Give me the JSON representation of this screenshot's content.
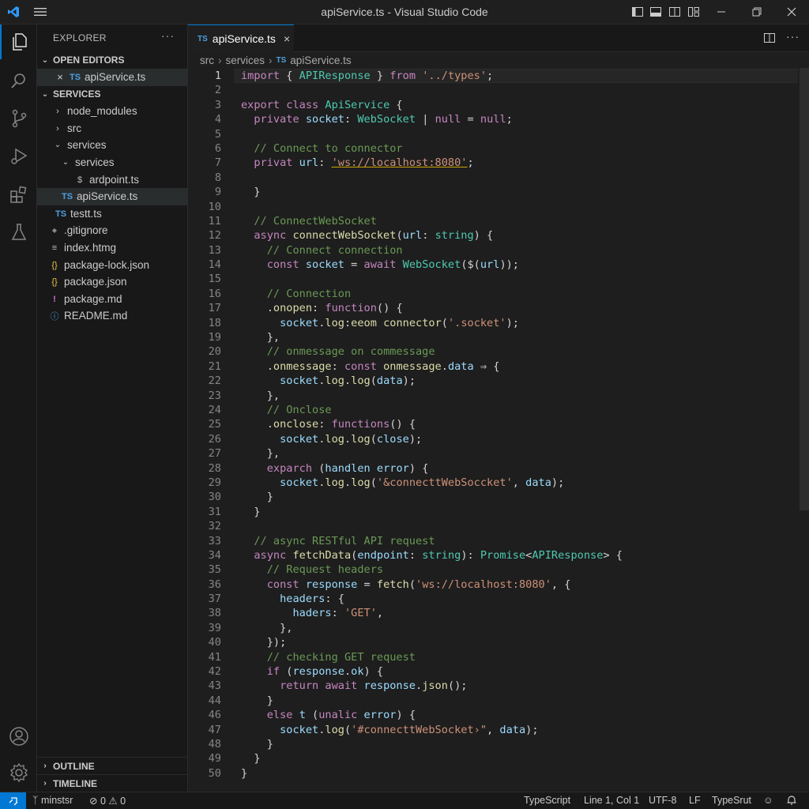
{
  "window": {
    "title": "apiService.ts - Visual Studio Code"
  },
  "activity_bar": [
    "explorer-icon",
    "search-icon",
    "source-control-icon",
    "run-debug-icon",
    "extensions-icon",
    "testing-icon",
    "account-icon",
    "manage-gear-icon"
  ],
  "sidebar": {
    "title": "EXPLORER",
    "more": "···",
    "open_editors": {
      "label": "OPEN EDITORS",
      "items": [
        {
          "icon": "TS",
          "label": "apiService.ts"
        }
      ]
    },
    "project": {
      "label": "SERVICES",
      "items": [
        {
          "chev": "›",
          "icon": "",
          "label": "node_modules"
        },
        {
          "chev": "›",
          "icon": "",
          "label": "src"
        },
        {
          "chev": "⌄",
          "icon": "",
          "label": "services"
        },
        {
          "chev": "⌄",
          "icon": "",
          "label": "services"
        },
        {
          "chev": "",
          "icon": "$",
          "label": "ardpoint.ts"
        },
        {
          "chev": "",
          "icon": "TS",
          "label": "apiService.ts"
        },
        {
          "chev": "",
          "icon": "TS",
          "label": "testt.ts"
        },
        {
          "chev": "",
          "icon": "◆",
          "label": ".gitignore"
        },
        {
          "chev": "",
          "icon": "≡",
          "label": "index.htmg"
        },
        {
          "chev": "",
          "icon": "{}",
          "label": "package-lock.json"
        },
        {
          "chev": "",
          "icon": "{}",
          "label": "package.json"
        },
        {
          "chev": "",
          "icon": "!",
          "label": "package.md"
        },
        {
          "chev": "",
          "icon": "ⓘ",
          "label": "README.md"
        }
      ]
    },
    "outline_label": "OUTLINE",
    "timeline_label": "TIMELINE"
  },
  "tab": {
    "icon": "TS",
    "label": "apiService.ts",
    "close": "×"
  },
  "breadcrumb": {
    "parts": [
      "src",
      "services",
      "apiService.ts"
    ],
    "file_icon": "TS",
    "sep": "›"
  },
  "editor": {
    "current_line": 1,
    "lines": [
      [
        [
          "kw",
          "import"
        ],
        [
          "p",
          " { "
        ],
        [
          "ty",
          "APIResponse"
        ],
        [
          "p",
          " } "
        ],
        [
          "kw",
          "from"
        ],
        [
          "p",
          " "
        ],
        [
          "str",
          "'../types'"
        ],
        [
          "p",
          ";"
        ]
      ],
      [],
      [
        [
          "kw",
          "export"
        ],
        [
          "p",
          " "
        ],
        [
          "kw",
          "class"
        ],
        [
          "p",
          " "
        ],
        [
          "ty",
          "ApiService"
        ],
        [
          "p",
          " {"
        ]
      ],
      [
        [
          "p",
          "  "
        ],
        [
          "kw",
          "private"
        ],
        [
          "p",
          " "
        ],
        [
          "var",
          "socket"
        ],
        [
          "p",
          ": "
        ],
        [
          "ty",
          "WebSocket"
        ],
        [
          "p",
          " | "
        ],
        [
          "kw",
          "null"
        ],
        [
          "p",
          " = "
        ],
        [
          "kw",
          "null"
        ],
        [
          "p",
          ";"
        ]
      ],
      [],
      [
        [
          "p",
          "  "
        ],
        [
          "cm",
          "// Connect to connector"
        ]
      ],
      [
        [
          "p",
          "  "
        ],
        [
          "kw",
          "privat"
        ],
        [
          "p",
          " "
        ],
        [
          "var",
          "url"
        ],
        [
          "p",
          ": "
        ],
        [
          "strU",
          "'ws://localhost:8080'"
        ],
        [
          "p",
          ";"
        ]
      ],
      [],
      [
        [
          "p",
          "  }"
        ]
      ],
      [],
      [
        [
          "p",
          "  "
        ],
        [
          "cm",
          "// ConnectWebSocket"
        ]
      ],
      [
        [
          "p",
          "  "
        ],
        [
          "kw",
          "async"
        ],
        [
          "p",
          " "
        ],
        [
          "fn",
          "connectWebSocket"
        ],
        [
          "p",
          "("
        ],
        [
          "var",
          "url"
        ],
        [
          "p",
          ": "
        ],
        [
          "ty",
          "string"
        ],
        [
          "p",
          ") {"
        ]
      ],
      [
        [
          "p",
          "    "
        ],
        [
          "cm",
          "// Connect connection"
        ]
      ],
      [
        [
          "p",
          "    "
        ],
        [
          "kw",
          "const"
        ],
        [
          "p",
          " "
        ],
        [
          "var",
          "socket"
        ],
        [
          "p",
          " = "
        ],
        [
          "kw",
          "await"
        ],
        [
          "p",
          " "
        ],
        [
          "ty",
          "WebSocket"
        ],
        [
          "p",
          "($("
        ],
        [
          "var",
          "url"
        ],
        [
          "p",
          "));"
        ]
      ],
      [],
      [
        [
          "p",
          "    "
        ],
        [
          "cm",
          "// Connection"
        ]
      ],
      [
        [
          "p",
          "    ."
        ],
        [
          "fn",
          "onopen"
        ],
        [
          "p",
          ": "
        ],
        [
          "kw",
          "function"
        ],
        [
          "p",
          "() {"
        ]
      ],
      [
        [
          "p",
          "      "
        ],
        [
          "var",
          "socket"
        ],
        [
          "p",
          "."
        ],
        [
          "fn",
          "log"
        ],
        [
          "p",
          ":"
        ],
        [
          "fn",
          "eeom"
        ],
        [
          "p",
          " "
        ],
        [
          "fn",
          "connector"
        ],
        [
          "p",
          "("
        ],
        [
          "str",
          "'.socket'"
        ],
        [
          "p",
          ");"
        ]
      ],
      [
        [
          "p",
          "    },"
        ]
      ],
      [
        [
          "p",
          "    "
        ],
        [
          "cm",
          "// onmessage on commessage"
        ]
      ],
      [
        [
          "p",
          "    ."
        ],
        [
          "fn",
          "onmessage"
        ],
        [
          "p",
          ": "
        ],
        [
          "kw",
          "const"
        ],
        [
          "p",
          " "
        ],
        [
          "fn",
          "onmessage"
        ],
        [
          "p",
          "."
        ],
        [
          "var",
          "data"
        ],
        [
          "p",
          " ⇒ {"
        ]
      ],
      [
        [
          "p",
          "      "
        ],
        [
          "var",
          "socket"
        ],
        [
          "p",
          "."
        ],
        [
          "fn",
          "log"
        ],
        [
          "p",
          "."
        ],
        [
          "fn",
          "log"
        ],
        [
          "p",
          "("
        ],
        [
          "var",
          "data"
        ],
        [
          "p",
          ");"
        ]
      ],
      [
        [
          "p",
          "    },"
        ]
      ],
      [
        [
          "p",
          "    "
        ],
        [
          "cm",
          "// Onclose"
        ]
      ],
      [
        [
          "p",
          "    ."
        ],
        [
          "fn",
          "onclose"
        ],
        [
          "p",
          ": "
        ],
        [
          "kw",
          "functions"
        ],
        [
          "p",
          "() {"
        ]
      ],
      [
        [
          "p",
          "      "
        ],
        [
          "var",
          "socket"
        ],
        [
          "p",
          "."
        ],
        [
          "fn",
          "log"
        ],
        [
          "p",
          "."
        ],
        [
          "fn",
          "log"
        ],
        [
          "p",
          "("
        ],
        [
          "var",
          "close"
        ],
        [
          "p",
          ");"
        ]
      ],
      [
        [
          "p",
          "    },"
        ]
      ],
      [
        [
          "p",
          "    "
        ],
        [
          "kw",
          "exparch"
        ],
        [
          "p",
          " ("
        ],
        [
          "var",
          "handlen"
        ],
        [
          "p",
          " "
        ],
        [
          "var",
          "error"
        ],
        [
          "p",
          ") {"
        ]
      ],
      [
        [
          "p",
          "      "
        ],
        [
          "var",
          "socket"
        ],
        [
          "p",
          "."
        ],
        [
          "fn",
          "log"
        ],
        [
          "p",
          "."
        ],
        [
          "fn",
          "log"
        ],
        [
          "p",
          "("
        ],
        [
          "str",
          "'&connecttWebSoccket'"
        ],
        [
          "p",
          ", "
        ],
        [
          "var",
          "data"
        ],
        [
          "p",
          ");"
        ]
      ],
      [
        [
          "p",
          "    }"
        ]
      ],
      [
        [
          "p",
          "  }"
        ]
      ],
      [],
      [
        [
          "p",
          "  "
        ],
        [
          "cm",
          "// async RESTful API request"
        ]
      ],
      [
        [
          "p",
          "  "
        ],
        [
          "kw",
          "async"
        ],
        [
          "p",
          " "
        ],
        [
          "fn",
          "fetchData"
        ],
        [
          "p",
          "("
        ],
        [
          "var",
          "endpoint"
        ],
        [
          "p",
          ": "
        ],
        [
          "ty",
          "string"
        ],
        [
          "p",
          "): "
        ],
        [
          "ty",
          "Promise"
        ],
        [
          "p",
          "<"
        ],
        [
          "ty",
          "APIResponse"
        ],
        [
          "p",
          "> {"
        ]
      ],
      [
        [
          "p",
          "    "
        ],
        [
          "cm",
          "// Request headers"
        ]
      ],
      [
        [
          "p",
          "    "
        ],
        [
          "kw",
          "const"
        ],
        [
          "p",
          " "
        ],
        [
          "var",
          "response"
        ],
        [
          "p",
          " = "
        ],
        [
          "fn",
          "fetch"
        ],
        [
          "p",
          "("
        ],
        [
          "str",
          "'ws://localhost:8080'"
        ],
        [
          "p",
          ", {"
        ]
      ],
      [
        [
          "p",
          "      "
        ],
        [
          "var",
          "headers"
        ],
        [
          "p",
          ": {"
        ]
      ],
      [
        [
          "p",
          "        "
        ],
        [
          "var",
          "haders"
        ],
        [
          "p",
          ": "
        ],
        [
          "str",
          "'GET'"
        ],
        [
          "p",
          ","
        ]
      ],
      [
        [
          "p",
          "      },"
        ]
      ],
      [
        [
          "p",
          "    });"
        ]
      ],
      [
        [
          "p",
          "    "
        ],
        [
          "cm",
          "// checking GET request"
        ]
      ],
      [
        [
          "p",
          "    "
        ],
        [
          "kw",
          "if"
        ],
        [
          "p",
          " ("
        ],
        [
          "var",
          "response"
        ],
        [
          "p",
          "."
        ],
        [
          "var",
          "ok"
        ],
        [
          "p",
          ") {"
        ]
      ],
      [
        [
          "p",
          "      "
        ],
        [
          "kw",
          "return"
        ],
        [
          "p",
          " "
        ],
        [
          "kw",
          "await"
        ],
        [
          "p",
          " "
        ],
        [
          "var",
          "response"
        ],
        [
          "p",
          "."
        ],
        [
          "fn",
          "json"
        ],
        [
          "p",
          "();"
        ]
      ],
      [
        [
          "p",
          "    }"
        ]
      ],
      [
        [
          "p",
          "    "
        ],
        [
          "kw",
          "else"
        ],
        [
          "p",
          " "
        ],
        [
          "var",
          "t"
        ],
        [
          "p",
          " ("
        ],
        [
          "kw",
          "unalic"
        ],
        [
          "p",
          " "
        ],
        [
          "var",
          "error"
        ],
        [
          "p",
          ") {"
        ]
      ],
      [
        [
          "p",
          "      "
        ],
        [
          "var",
          "socket"
        ],
        [
          "p",
          "."
        ],
        [
          "fn",
          "log"
        ],
        [
          "p",
          "("
        ],
        [
          "str",
          "'#connecttWebSocket›\""
        ],
        [
          "p",
          ", "
        ],
        [
          "var",
          "data"
        ],
        [
          "p",
          ");"
        ]
      ],
      [
        [
          "p",
          "    }"
        ]
      ],
      [
        [
          "p",
          "  }"
        ]
      ],
      [
        [
          "p",
          "}"
        ]
      ],
      []
    ],
    "line_numbers": [
      "1",
      "2",
      "3",
      "4",
      "5",
      "6",
      "7",
      "8",
      "9",
      "10",
      "11",
      "12",
      "13",
      "14",
      "15",
      "16",
      "17",
      "18",
      "19",
      "20",
      "21",
      "22",
      "23",
      "24",
      "25",
      "26",
      "27",
      "28",
      "29",
      "30",
      "31",
      "32",
      "33",
      "34",
      "35",
      "36",
      "37",
      "38",
      "39",
      "40",
      "41",
      "42",
      "43",
      "44",
      "46",
      "47",
      "48",
      "49",
      "50"
    ]
  },
  "statusbar": {
    "branch": "minstsr",
    "errors": "0",
    "warnings": "0",
    "language_left": "TypeScript",
    "cursor": "Line 1, Col 1",
    "encoding": "UTF-8",
    "eol": "LF",
    "language_right": "TypeSrut"
  },
  "colors": {
    "kw": "#c586c0",
    "ty": "#4ec9b0",
    "fn": "#dcdcaa",
    "var": "#9cdcfe",
    "str": "#ce9178",
    "cm": "#6a9955",
    "accent": "#0078d4"
  }
}
